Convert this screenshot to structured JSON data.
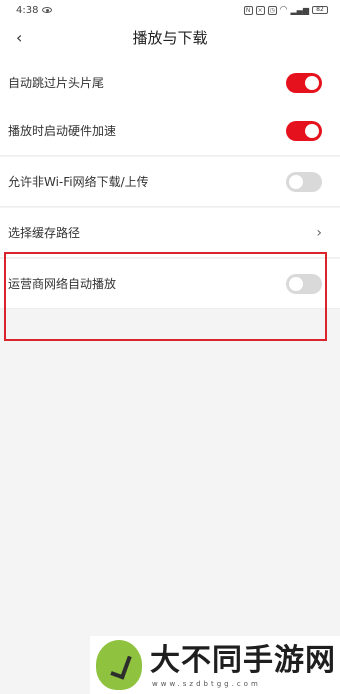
{
  "status_bar": {
    "time": "4:38",
    "battery": "82"
  },
  "header": {
    "back_icon": "‹",
    "title": "播放与下载"
  },
  "settings": [
    {
      "label": "自动跳过片头片尾",
      "control": "toggle",
      "on": true
    },
    {
      "label": "播放时启动硬件加速",
      "control": "toggle",
      "on": true
    },
    {
      "label": "允许非Wi-Fi网络下载/上传",
      "control": "toggle",
      "on": false
    },
    {
      "label": "选择缓存路径",
      "control": "chevron",
      "chevron": "›"
    },
    {
      "label": "运营商网络自动播放",
      "control": "toggle",
      "on": false
    }
  ],
  "colors": {
    "accent": "#e5121d",
    "toggle_off": "#d9d9d9",
    "highlight_border": "#d9232d"
  },
  "watermark": {
    "title": "大不同手游网",
    "url": "www.szdbtgg.com"
  }
}
